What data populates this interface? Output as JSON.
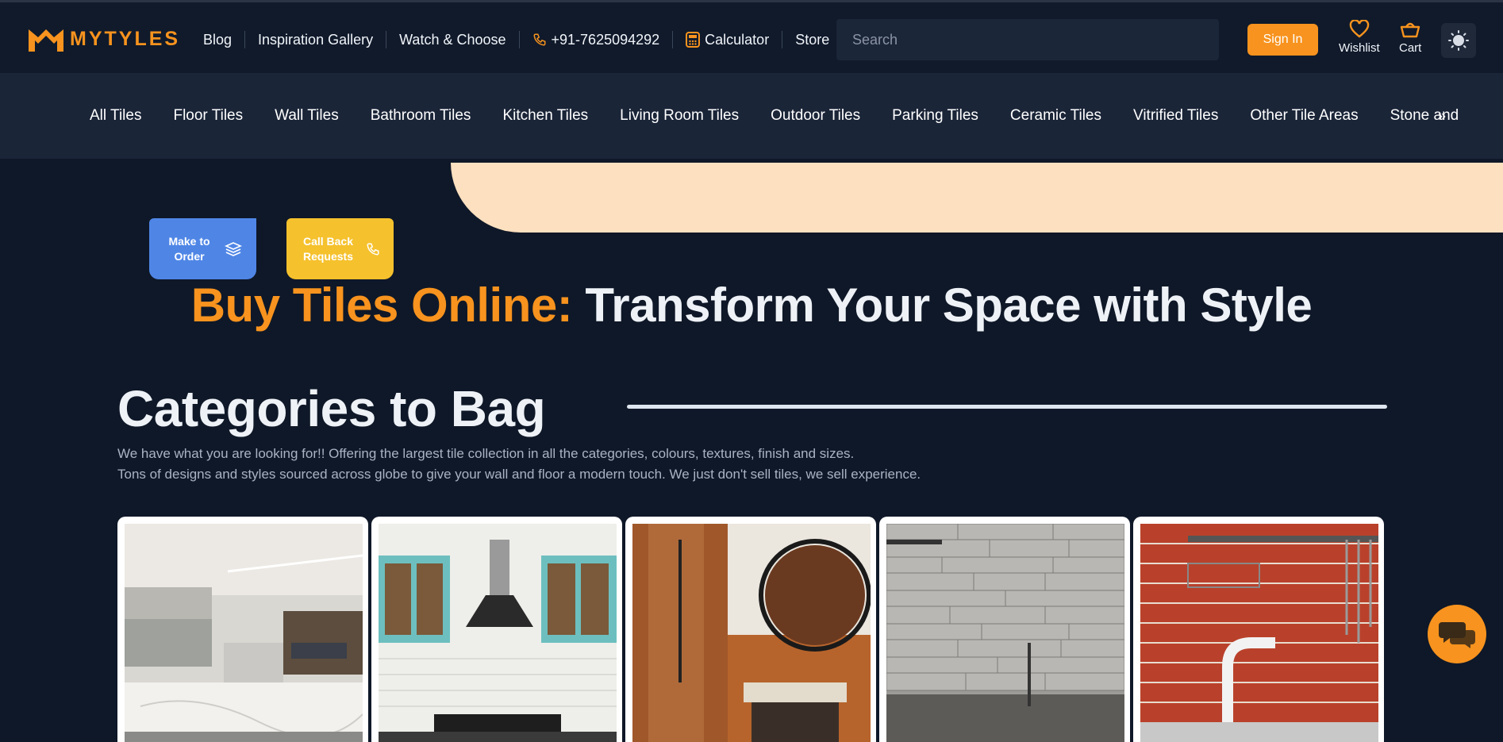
{
  "header": {
    "logo_text": "MYTYLES",
    "nav": [
      {
        "label": "Blog"
      },
      {
        "label": "Inspiration Gallery"
      },
      {
        "label": "Watch & Choose"
      },
      {
        "label": "+91-7625094292",
        "icon": "phone-icon"
      },
      {
        "label": "Calculator",
        "icon": "calculator-icon"
      },
      {
        "label": "Store"
      }
    ],
    "search_placeholder": "Search",
    "sign_in": "Sign In",
    "wishlist": "Wishlist",
    "cart": "Cart",
    "theme_icon": "sun-icon"
  },
  "categories_nav": [
    "All Tiles",
    "Floor Tiles",
    "Wall Tiles",
    "Bathroom Tiles",
    "Kitchen Tiles",
    "Living Room Tiles",
    "Outdoor Tiles",
    "Parking Tiles",
    "Ceramic Tiles",
    "Vitrified Tiles",
    "Other Tile Areas",
    "Stone and Natural"
  ],
  "categories_more": "»",
  "cta": {
    "make_to_order": "Make to Order",
    "call_back": "Call Back Requests"
  },
  "hero": {
    "accent": "Buy Tiles Online:",
    "rest": " Transform Your Space with Style"
  },
  "section": {
    "title": "Categories to Bag",
    "desc_line1": "We have what you are looking for!! Offering the largest tile collection in all the categories, colours, textures, finish and sizes.",
    "desc_line2": "Tons of designs and styles sourced across globe to give your wall and floor a modern touch. We just don't sell tiles, we sell experience."
  },
  "cards": [
    {
      "name": "card-kitchen-marble"
    },
    {
      "name": "card-kitchen-subway"
    },
    {
      "name": "card-bathroom-wood"
    },
    {
      "name": "card-stone-wall"
    },
    {
      "name": "card-red-brick"
    }
  ],
  "colors": {
    "accent": "#f7931e",
    "background": "#0f1828",
    "nav_bar": "#1b2538",
    "peach": "#fde0bf",
    "cta_blue": "#4f86e6",
    "cta_yellow": "#f5c12d"
  }
}
